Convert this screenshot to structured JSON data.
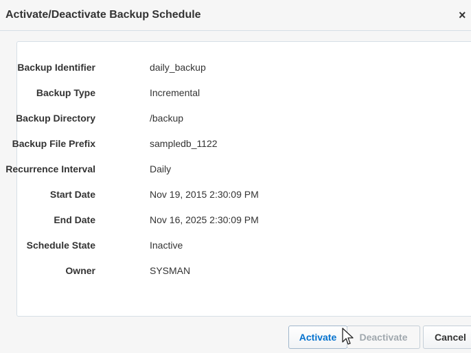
{
  "dialog": {
    "title": "Activate/Deactivate Backup Schedule",
    "close_label": "×"
  },
  "details": [
    {
      "label": "Backup Identifier",
      "value": "daily_backup"
    },
    {
      "label": "Backup Type",
      "value": "Incremental"
    },
    {
      "label": "Backup Directory",
      "value": "/backup"
    },
    {
      "label": "Backup File Prefix",
      "value": "sampledb_1122"
    },
    {
      "label": "Recurrence Interval",
      "value": "Daily"
    },
    {
      "label": "Start Date",
      "value": "Nov 19, 2015 2:30:09 PM"
    },
    {
      "label": "End Date",
      "value": "Nov 16, 2025 2:30:09 PM"
    },
    {
      "label": "Schedule State",
      "value": "Inactive"
    },
    {
      "label": "Owner",
      "value": "SYSMAN"
    }
  ],
  "buttons": {
    "activate": "Activate",
    "deactivate": "Deactivate",
    "cancel": "Cancel"
  },
  "colors": {
    "accent": "#0572ce",
    "disabled_text": "#a0a8ae",
    "border": "#d6dfe6"
  },
  "icons": {
    "close": "close-icon",
    "cursor": "mouse-pointer-icon"
  }
}
